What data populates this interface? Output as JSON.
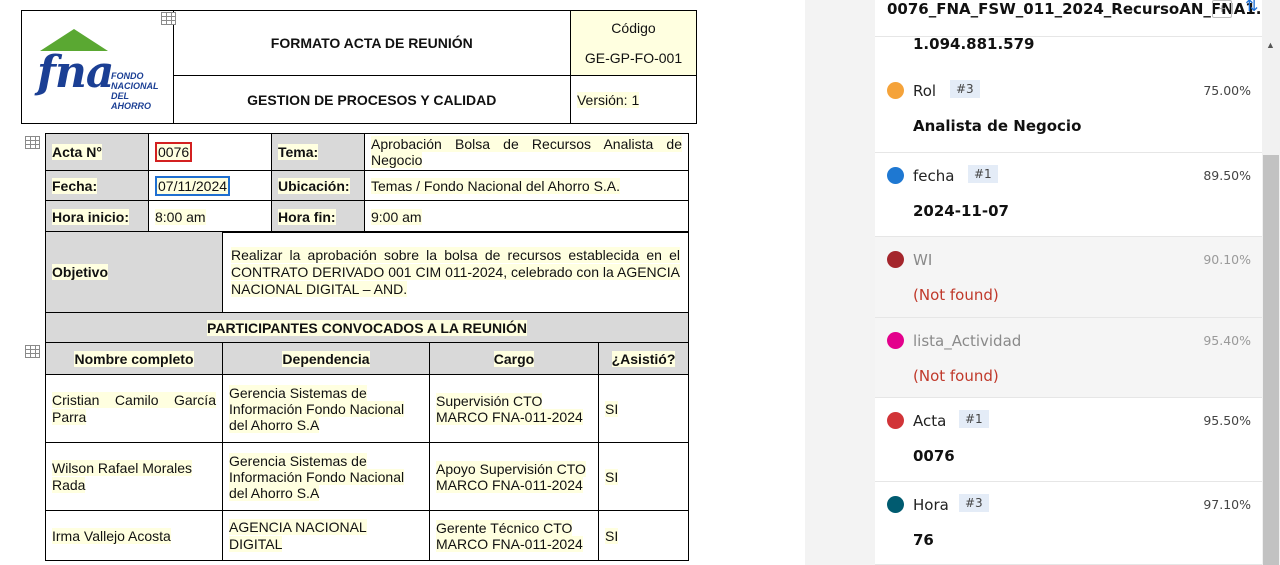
{
  "document": {
    "header": {
      "logo": {
        "name": "fna",
        "text_lines": [
          "FONDO",
          "NACIONAL",
          "DEL AHORRO"
        ],
        "roof_color": "#5aa832",
        "text_color": "#1b3f94"
      },
      "title": "FORMATO ACTA DE REUNIÓN",
      "subtitle": "GESTION DE PROCESOS Y CALIDAD",
      "codigo_label": "Código",
      "codigo_value": "GE-GP-FO-001",
      "version": "Versión: 1"
    },
    "acta": {
      "acta_label": "Acta N°",
      "acta_value": "0076",
      "tema_label": "Tema:",
      "tema_value": "Aprobación Bolsa de Recursos Analista de Negocio",
      "fecha_label": "Fecha:",
      "fecha_value": "07/11/2024",
      "ubicacion_label": "Ubicación:",
      "ubicacion_value": "Temas / Fondo Nacional del Ahorro S.A.",
      "hora_inicio_label": "Hora inicio:",
      "hora_inicio_value": "8:00 am",
      "hora_fin_label": "Hora fin:",
      "hora_fin_value": "9:00 am",
      "objetivo_label": "Objetivo",
      "objetivo_value": "Realizar la aprobación sobre la bolsa de recursos establecida en el CONTRATO DERIVADO 001 CIM 011-2024, celebrado con la AGENCIA NACIONAL DIGITAL – AND."
    },
    "participantes": {
      "title": "PARTICIPANTES CONVOCADOS A LA REUNIÓN",
      "headers": [
        "Nombre completo",
        "Dependencia",
        "Cargo",
        "¿Asistió?"
      ],
      "rows": [
        {
          "nombre": "Cristian Camilo García Parra",
          "dependencia": "Gerencia Sistemas de Información Fondo Nacional del Ahorro S.A",
          "cargo": "Supervisión CTO MARCO FNA-011-2024",
          "asistio": "SI"
        },
        {
          "nombre": "Wilson Rafael Morales Rada",
          "dependencia": "Gerencia Sistemas de Información Fondo Nacional del Ahorro S.A",
          "cargo": "Apoyo Supervisión CTO MARCO FNA-011-2024",
          "asistio": "SI"
        },
        {
          "nombre": "Irma Vallejo Acosta",
          "dependencia": "AGENCIA NACIONAL DIGITAL",
          "cargo": "Gerente Técnico CTO MARCO FNA-011-2024",
          "asistio": "SI"
        }
      ]
    }
  },
  "panel": {
    "file_title": "0076_FNA_FSW_011_2024_RecursoAN_FNA1...",
    "file_icon": "new-file-icon",
    "sort_icon": "sort-arrows-icon",
    "top_value": "1.094.881.579",
    "fields": [
      {
        "name": "Rol",
        "badge": "#3",
        "percent": "75.00%",
        "value": "Analista de Negocio",
        "color": "#f5a33a",
        "found": true
      },
      {
        "name": "fecha",
        "badge": "#1",
        "percent": "89.50%",
        "value": "2024-11-07",
        "color": "#1e78d2",
        "found": true
      },
      {
        "name": "WI",
        "badge": "",
        "percent": "90.10%",
        "value": "(Not found)",
        "color": "#a4262c",
        "found": false
      },
      {
        "name": "lista_Actividad",
        "badge": "",
        "percent": "95.40%",
        "value": "(Not found)",
        "color": "#e3008c",
        "found": false
      },
      {
        "name": "Acta",
        "badge": "#1",
        "percent": "95.50%",
        "value": "0076",
        "color": "#d13438",
        "found": true
      },
      {
        "name": "Hora",
        "badge": "#3",
        "percent": "97.10%",
        "value": "76",
        "color": "#005b70",
        "found": true
      }
    ]
  }
}
